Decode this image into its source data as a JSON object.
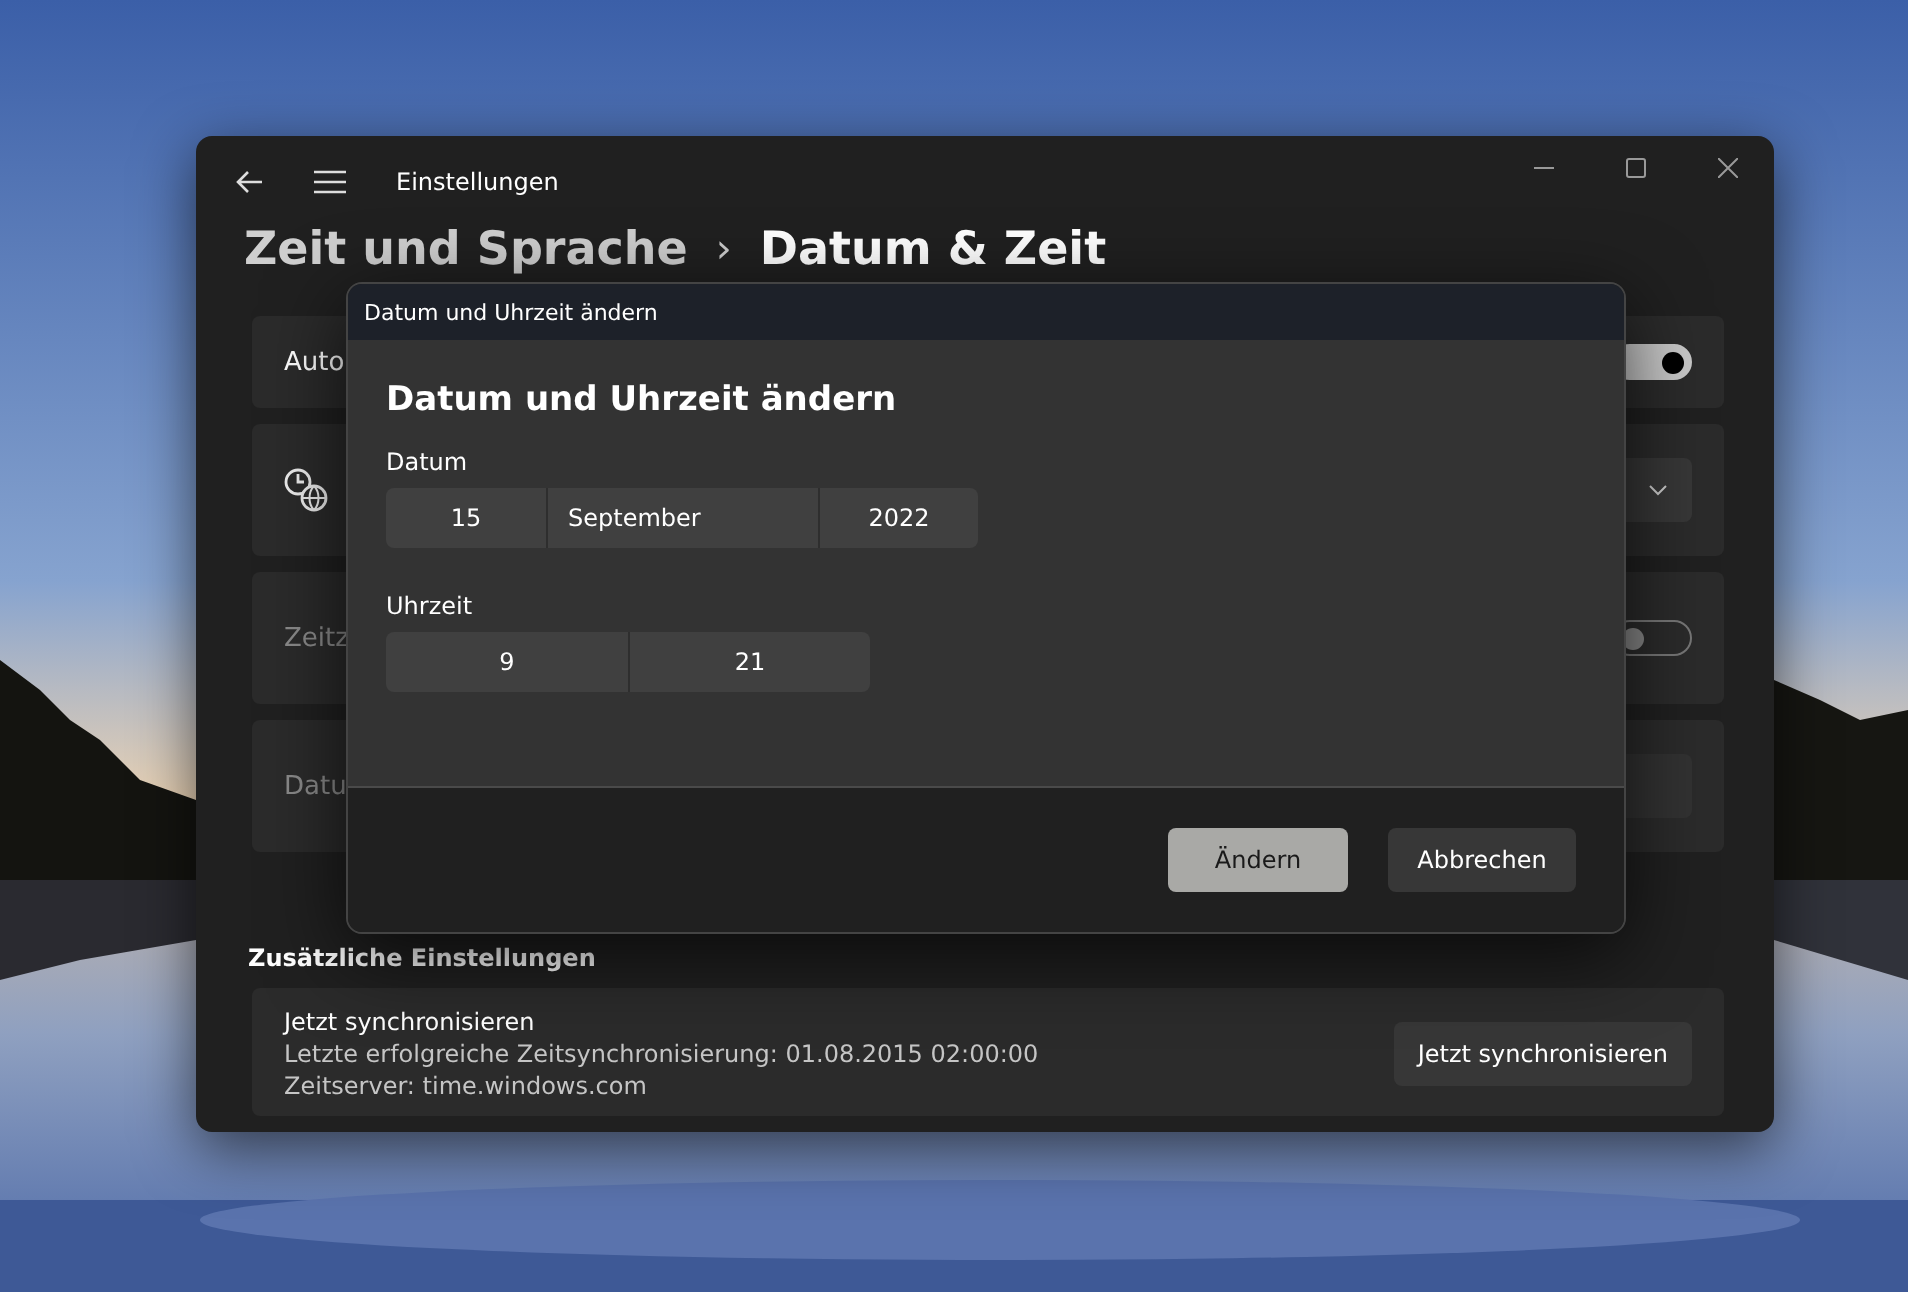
{
  "window": {
    "title": "Einstellungen"
  },
  "breadcrumb": {
    "parent": "Zeit und Sprache",
    "separator": "›",
    "current": "Datum & Zeit"
  },
  "cards": [
    {
      "label": "Auto",
      "kind": "toggle",
      "on": true,
      "disabled": false
    },
    {
      "kind": "dropdown"
    },
    {
      "label": "Zeitz",
      "kind": "toggle",
      "on": false,
      "disabled": true
    },
    {
      "label": "Datu",
      "kind": "button",
      "disabled": true
    }
  ],
  "section_heading": "Zusätzliche Einstellungen",
  "sync_card": {
    "title": "Jetzt synchronisieren",
    "lines": [
      "Letzte erfolgreiche Zeitsynchronisierung: 01.08.2015 02:00:00",
      "Zeitserver: time.windows.com"
    ],
    "button": "Jetzt synchronisieren"
  },
  "dialog": {
    "title": "Datum und Uhrzeit ändern",
    "heading": "Datum und Uhrzeit ändern",
    "date": {
      "label": "Datum",
      "day": "15",
      "month": "September",
      "year": "2022"
    },
    "time": {
      "label": "Uhrzeit",
      "hour": "9",
      "minute": "21"
    },
    "buttons": [
      {
        "label": "Ändern",
        "primary": true
      },
      {
        "label": "Abbrechen",
        "primary": false
      }
    ]
  }
}
